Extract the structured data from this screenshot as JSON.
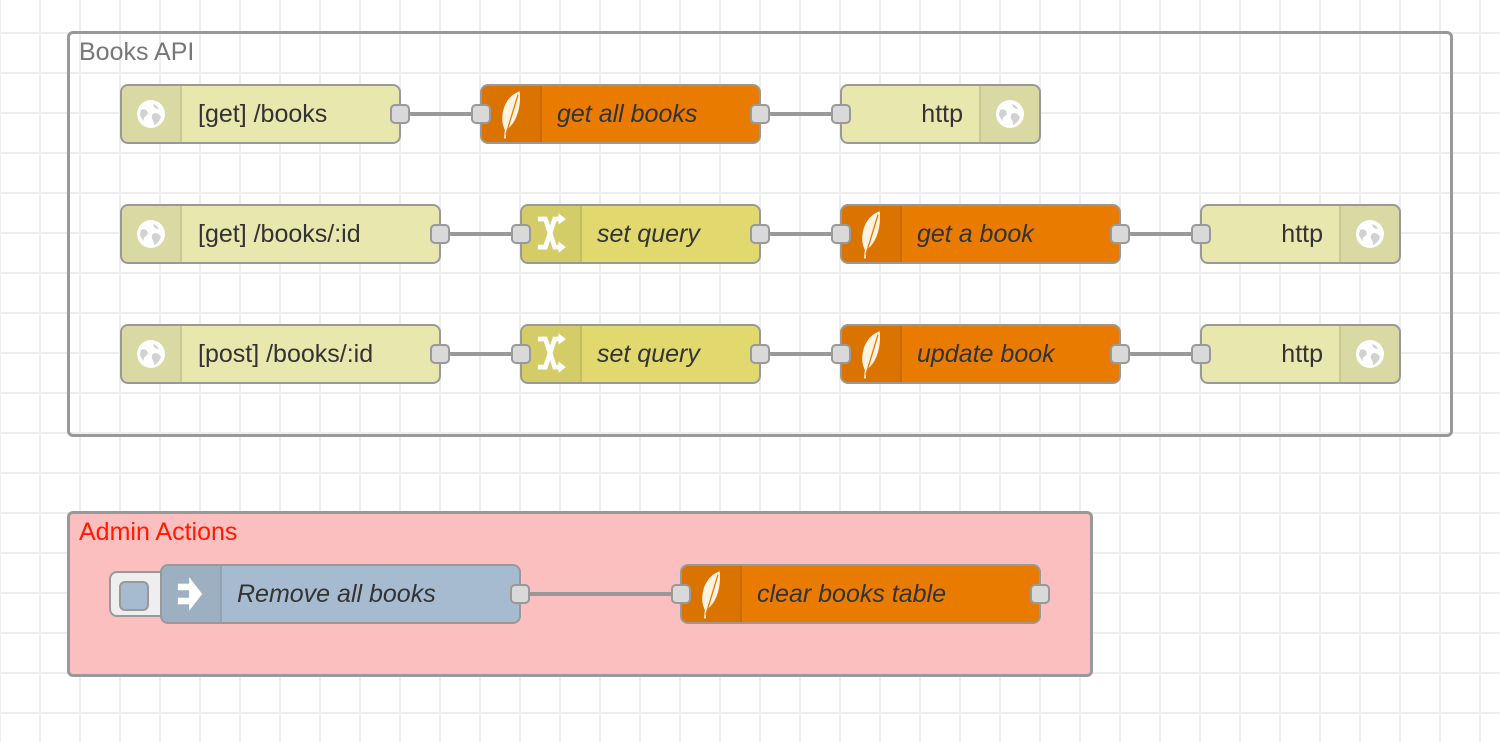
{
  "colors": {
    "http_in": "#e7e7ae",
    "change": "#e2d96e",
    "function": "#e97b00",
    "inject": "#a6bbcf",
    "admin_group_bg": "#fbbfbf",
    "admin_group_label": "#ff1a00",
    "books_group_label": "#777777"
  },
  "groups": [
    {
      "id": "books-api",
      "label": "Books API"
    },
    {
      "id": "admin-actions",
      "label": "Admin Actions"
    }
  ],
  "nodes": {
    "get_books": {
      "type": "http in",
      "label": "[get] /books",
      "icon": "globe-icon"
    },
    "get_all_books": {
      "type": "function",
      "label": "get all books",
      "icon": "feather-icon"
    },
    "http_resp_1": {
      "type": "http response",
      "label": "http",
      "icon": "globe-icon"
    },
    "get_book_id": {
      "type": "http in",
      "label": "[get] /books/:id",
      "icon": "globe-icon"
    },
    "set_query_1": {
      "type": "change",
      "label": "set query",
      "icon": "shuffle-icon"
    },
    "get_a_book": {
      "type": "function",
      "label": "get a book",
      "icon": "feather-icon"
    },
    "http_resp_2": {
      "type": "http response",
      "label": "http",
      "icon": "globe-icon"
    },
    "post_book_id": {
      "type": "http in",
      "label": "[post] /books/:id",
      "icon": "globe-icon"
    },
    "set_query_2": {
      "type": "change",
      "label": "set query",
      "icon": "shuffle-icon"
    },
    "update_book": {
      "type": "function",
      "label": "update book",
      "icon": "feather-icon"
    },
    "http_resp_3": {
      "type": "http response",
      "label": "http",
      "icon": "globe-icon"
    },
    "remove_all_books": {
      "type": "inject",
      "label": "Remove all books",
      "icon": "arrow-right-icon"
    },
    "clear_books_table": {
      "type": "function",
      "label": "clear books table",
      "icon": "feather-icon"
    }
  },
  "wires": [
    [
      "get_books",
      "get_all_books"
    ],
    [
      "get_all_books",
      "http_resp_1"
    ],
    [
      "get_book_id",
      "set_query_1"
    ],
    [
      "set_query_1",
      "get_a_book"
    ],
    [
      "get_a_book",
      "http_resp_2"
    ],
    [
      "post_book_id",
      "set_query_2"
    ],
    [
      "set_query_2",
      "update_book"
    ],
    [
      "update_book",
      "http_resp_3"
    ],
    [
      "remove_all_books",
      "clear_books_table"
    ]
  ]
}
